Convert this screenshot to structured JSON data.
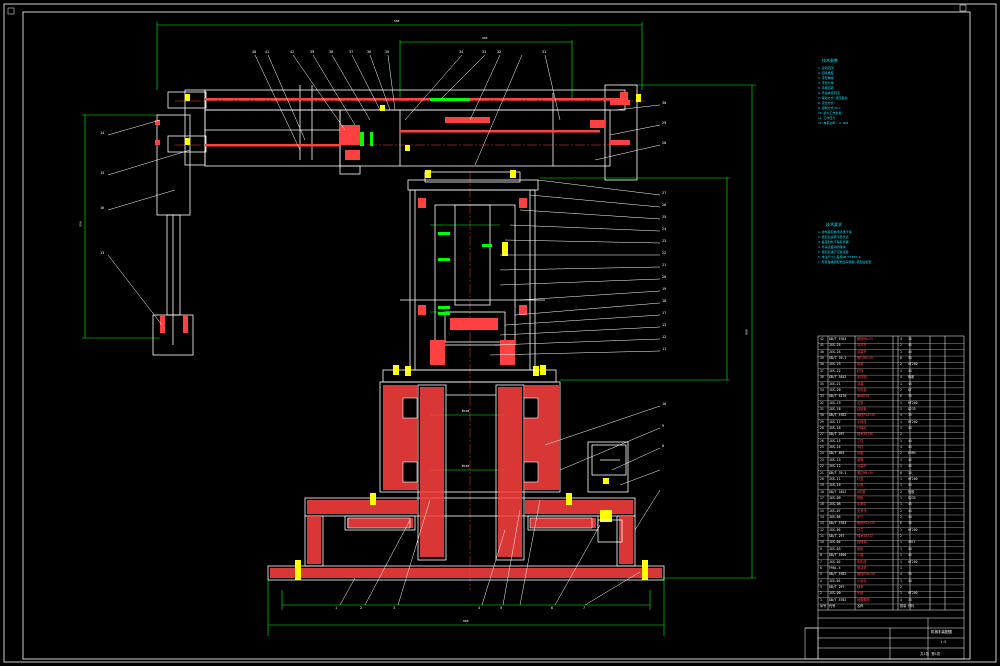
{
  "drawing": {
    "colors": {
      "frame": "#ffffff",
      "dimension": "#00ff00",
      "hatch": "#ff4040",
      "note": "#00e5ff",
      "part": "#ffffff",
      "highlight": "#ff00ff",
      "yellow": "#ffff00"
    }
  },
  "dims": {
    "top_overall": "500",
    "top_inner": "300",
    "left_vertical": "550",
    "right_vertical": "800",
    "base_width": "800",
    "column_mid": "Φ100",
    "column_lower": "Φ160"
  },
  "part_numbers_left": [
    "14",
    "15",
    "16",
    "13"
  ],
  "part_numbers_top": [
    "40",
    "41",
    "42",
    "39",
    "38",
    "37",
    "36",
    "35",
    "34",
    "33",
    "32",
    "31"
  ],
  "part_numbers_right": [
    "30",
    "29",
    "28",
    "27",
    "26",
    "25",
    "24",
    "23",
    "22",
    "21",
    "20",
    "19",
    "18",
    "17",
    "13",
    "12",
    "11",
    "10",
    "9",
    "8"
  ],
  "part_numbers_bottom": [
    "1",
    "2",
    "3",
    "4",
    "5",
    "6",
    "7"
  ],
  "notes": {
    "top_title": "技术参数",
    "top_lines": [
      "1.运动范围",
      "2.回转角度",
      "3.手臂伸缩",
      "4.手臂升降",
      "5.手腕回转",
      "6.手指夹持范围",
      "7.驱动方式:液压驱动",
      "8.定位方式:",
      "9.控制方式:PLC",
      "10.最大工作负载:",
      "11.工作压力",
      "12.电机功率: 2.2KW"
    ],
    "bottom_title": "技术要求",
    "bottom_lines": [
      "1.零件装配前须清洗干净",
      "2.装配后运转平稳灵活",
      "3.各密封处不得有泄漏",
      "4.外露表面涂防锈漆",
      "5.装配后进行空载试验",
      "6.未注尺寸公差按GB/T1804-m",
      "7.所有轴承装配前注润滑脂,装配后检查"
    ]
  },
  "title_block": {
    "rows": [
      [
        "42",
        "GB/T 5783",
        "螺栓M8×25",
        "4",
        "35"
      ],
      [
        "41",
        "JXS-25",
        "导向杆",
        "2",
        "45"
      ],
      [
        "40",
        "JXS-24",
        "活塞杆",
        "1",
        "45"
      ],
      [
        "39",
        "GB/T 70.1",
        "螺钉M6×20",
        "8",
        "35"
      ],
      [
        "38",
        "JXS-23",
        "端盖",
        "2",
        "HT200"
      ],
      [
        "37",
        "JXS-22",
        "缸体",
        "1",
        "45"
      ],
      [
        "36",
        "GB/T 3452",
        "密封圈",
        "4",
        "橡胶"
      ],
      [
        "35",
        "JXS-21",
        "活塞",
        "1",
        "45"
      ],
      [
        "34",
        "JXS-20",
        "导向套",
        "2",
        "QT"
      ],
      [
        "33",
        "GB/T 6170",
        "螺母M10",
        "6",
        "35"
      ],
      [
        "32",
        "JXS-19",
        "支架",
        "1",
        "HT200"
      ],
      [
        "31",
        "JXS-18",
        "连接板",
        "1",
        "Q235"
      ],
      [
        "30",
        "GB/T 5782",
        "螺栓M10×40",
        "4",
        "35"
      ],
      [
        "29",
        "JXS-17",
        "手臂座",
        "1",
        "HT200"
      ],
      [
        "28",
        "JXS-16",
        "升降缸",
        "1",
        "45"
      ],
      [
        "27",
        "GB/T 297",
        "轴承30208",
        "2",
        ""
      ],
      [
        "26",
        "JXS-15",
        "立柱",
        "1",
        "45"
      ],
      [
        "25",
        "JXS-14",
        "导柱",
        "4",
        "45"
      ],
      [
        "24",
        "GB/T 893",
        "挡圈",
        "2",
        "65Mn"
      ],
      [
        "23",
        "JXS-13",
        "套筒",
        "1",
        "45"
      ],
      [
        "22",
        "JXS-12",
        "活塞杆",
        "1",
        "45"
      ],
      [
        "21",
        "GB/T 70.1",
        "螺钉M8×30",
        "8",
        "35"
      ],
      [
        "20",
        "JXS-11",
        "缸盖",
        "1",
        "HT200"
      ],
      [
        "19",
        "JXS-10",
        "缸筒",
        "1",
        "45"
      ],
      [
        "18",
        "GB/T 3452",
        "O形圈",
        "2",
        "橡胶"
      ],
      [
        "17",
        "JXS-09",
        "底板",
        "1",
        "Q235"
      ],
      [
        "16",
        "JXS-08",
        "手腕缸",
        "1",
        "45"
      ],
      [
        "15",
        "JXS-07",
        "夹紧块",
        "2",
        "45"
      ],
      [
        "14",
        "JXS-06",
        "手爪",
        "2",
        "45"
      ],
      [
        "13",
        "GB/T 5783",
        "螺栓M12×35",
        "6",
        "35"
      ],
      [
        "12",
        "JXS-05",
        "法兰",
        "1",
        "HT200"
      ],
      [
        "11",
        "GB/T 297",
        "轴承30212",
        "2",
        ""
      ],
      [
        "10",
        "JXS-04",
        "回转轴",
        "1",
        "40Cr"
      ],
      [
        "9",
        "JXS-03",
        "齿轮",
        "1",
        "45"
      ],
      [
        "8",
        "GB/T 1096",
        "平键",
        "1",
        "45"
      ],
      [
        "7",
        "JXS-02",
        "电机座",
        "1",
        "HT200"
      ],
      [
        "6",
        "Y90L-4",
        "电动机",
        "1",
        ""
      ],
      [
        "5",
        "GB/T 5782",
        "螺栓M16×50",
        "4",
        "35"
      ],
      [
        "4",
        "JXS-01",
        "小齿轮",
        "1",
        "45"
      ],
      [
        "3",
        "GB/T 297",
        "轴承",
        "2",
        ""
      ],
      [
        "2",
        "JXS-00",
        "底座",
        "1",
        "HT200"
      ],
      [
        "1",
        "GB/T 5782",
        "地脚螺栓",
        "4",
        "35"
      ]
    ],
    "header": [
      "序号",
      "代号",
      "名称",
      "数量",
      "材料"
    ],
    "drawing_name": "机械手装配图",
    "scale": "1:5",
    "sheet": "共1张 第1张"
  }
}
